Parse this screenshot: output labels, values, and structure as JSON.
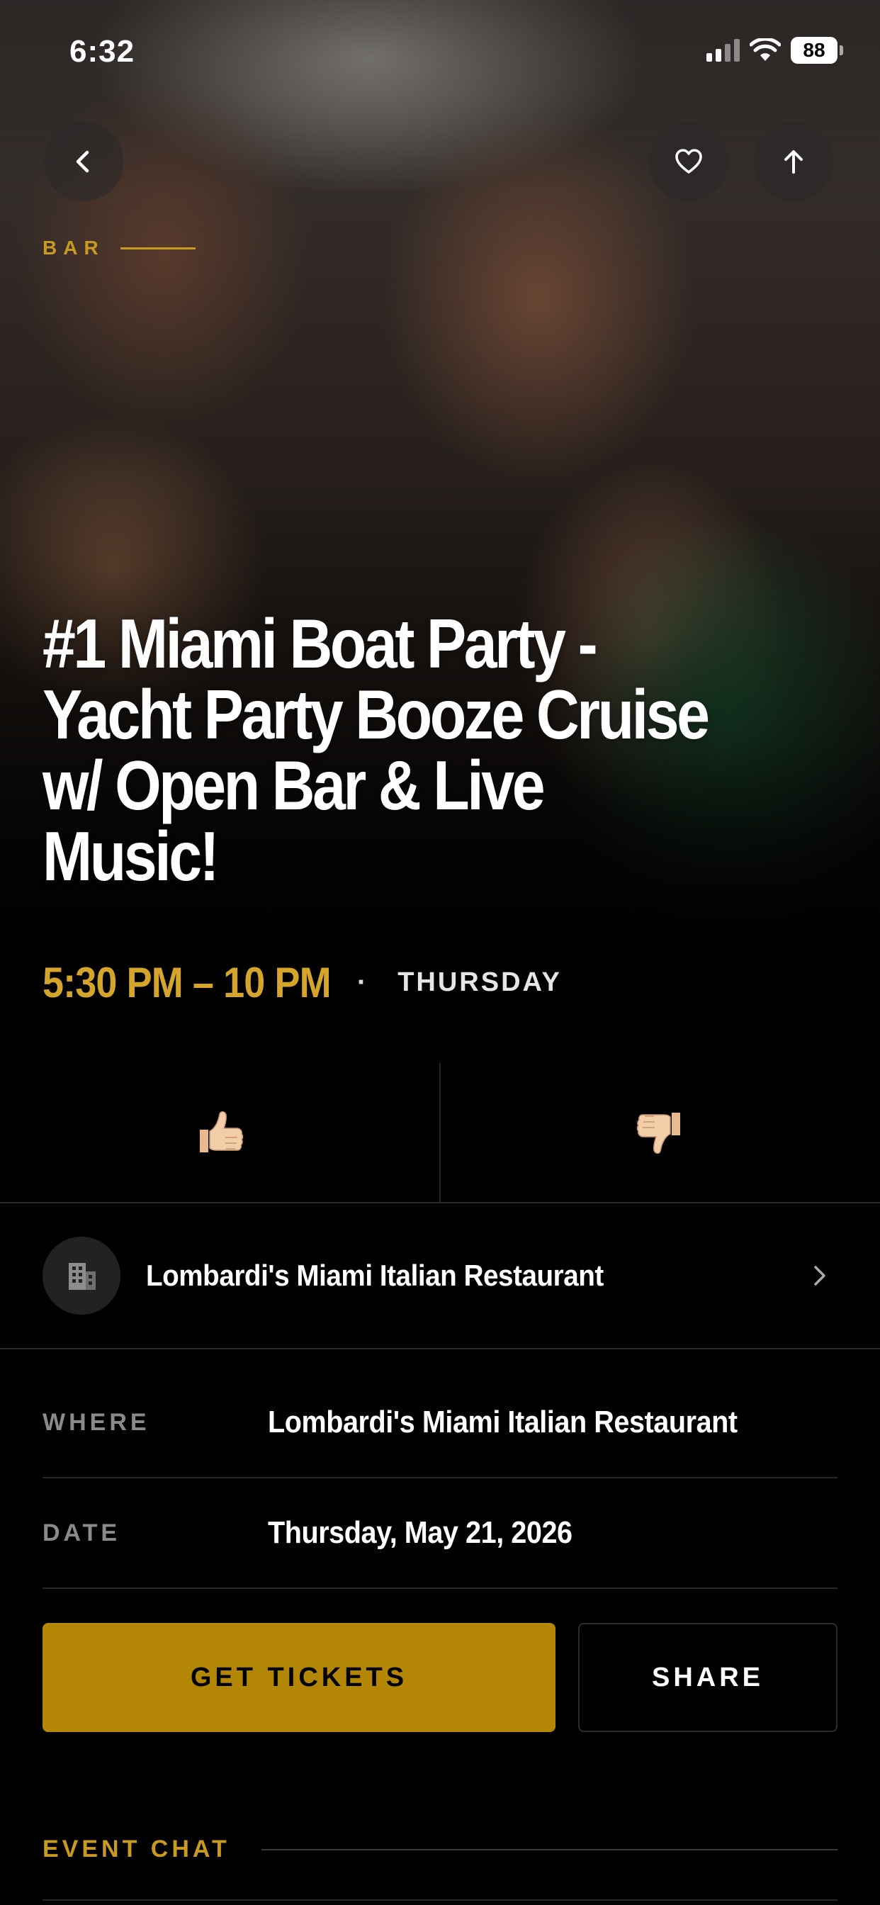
{
  "status_bar": {
    "time": "6:32",
    "battery": "88"
  },
  "nav": {
    "back_icon": "chevron-left-icon",
    "favorite_icon": "heart-icon",
    "share_icon": "arrow-up-icon"
  },
  "event": {
    "category": "BAR",
    "title": "#1 Miami Boat Party - Yacht Party Booze Cruise w/ Open Bar & Live Music!",
    "time_range": "5:30 PM – 10 PM",
    "separator": "·",
    "day": "THURSDAY"
  },
  "vote": {
    "up_icon": "thumbs-up-icon",
    "down_icon": "thumbs-down-icon"
  },
  "venue": {
    "name": "Lombardi's Miami Italian Restaurant",
    "icon": "building-icon"
  },
  "details": [
    {
      "label": "WHERE",
      "value": "Lombardi's Miami Italian Restaurant"
    },
    {
      "label": "DATE",
      "value": "Thursday, May 21, 2026"
    }
  ],
  "actions": {
    "tickets_label": "GET TICKETS",
    "share_label": "SHARE"
  },
  "chat": {
    "header": "EVENT CHAT"
  },
  "colors": {
    "accent": "#c99a22",
    "tickets_button": "#b38606",
    "background": "#000000"
  }
}
